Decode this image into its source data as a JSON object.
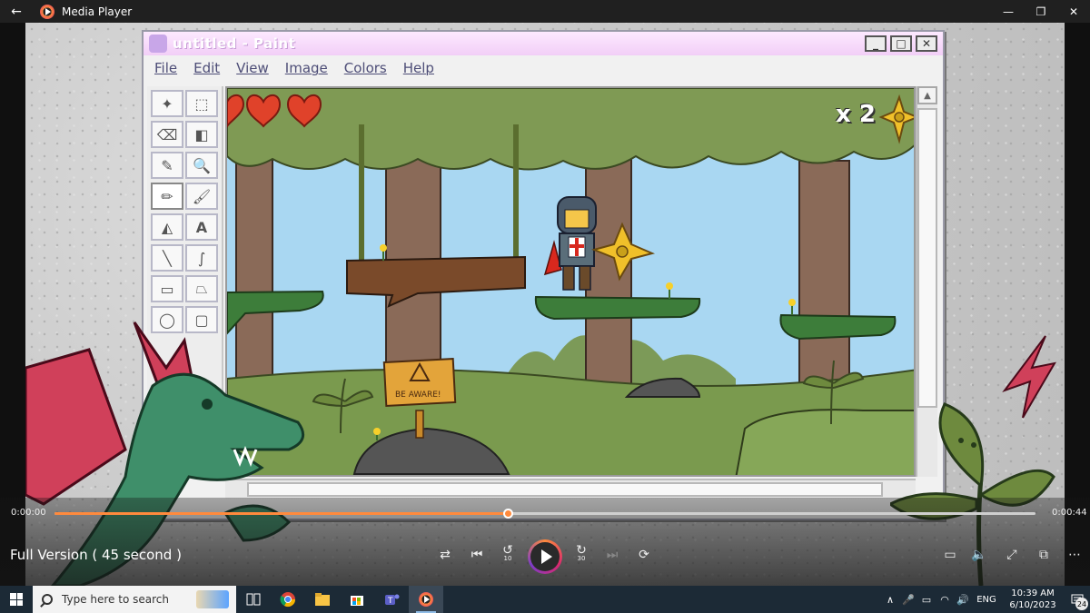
{
  "window": {
    "title": "Media Player",
    "back_glyph": "←",
    "minimize_glyph": "—",
    "restore_glyph": "❐",
    "close_glyph": "✕"
  },
  "paint": {
    "title": "untitled - Paint",
    "menu": [
      "File",
      "Edit",
      "View",
      "Image",
      "Colors",
      "Help"
    ],
    "ctrl_min": "_",
    "ctrl_max": "□",
    "ctrl_close": "✕",
    "tools": [
      "✦",
      "⬚",
      "⌫",
      "◧",
      "✎",
      "🔍",
      "✏",
      "🖌",
      "◭",
      "A",
      "╲",
      "∫",
      "▭",
      "⏢",
      "◯",
      "▢"
    ]
  },
  "game": {
    "lives_count": "x 2",
    "sign_text": "BE AWARE!"
  },
  "player": {
    "time_elapsed": "0:00:00",
    "time_total": "0:00:44",
    "progress": 0.462,
    "media_title": "Full Version ( 45 second )",
    "shuffle_glyph": "⇄",
    "prev_glyph": "⏮",
    "back10_glyph": "↺",
    "back10_label": "10",
    "fwd30_glyph": "↻",
    "fwd30_label": "30",
    "next_glyph": "⏭",
    "repeat_glyph": "⟳",
    "captions_glyph": "▭",
    "volume_glyph": "🔈",
    "fullscreen_glyph": "⤢",
    "miniplayer_glyph": "⧉",
    "more_glyph": "⋯"
  },
  "taskbar": {
    "search_placeholder": "Type here to search",
    "time": "10:39 AM",
    "date": "6/10/2023",
    "language": "ENG",
    "notifications_count": "24",
    "tray_up_glyph": "∧",
    "mic_glyph": "🎤",
    "battery_glyph": "▭",
    "wifi_glyph": "◠",
    "speaker_glyph": "🔊"
  },
  "colors": {
    "accent": "#ff8a3d",
    "taskbar": "#1c2a36",
    "titlebar": "#202020"
  }
}
